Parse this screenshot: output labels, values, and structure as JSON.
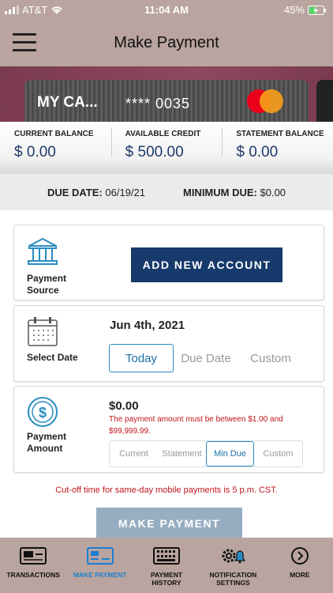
{
  "status_bar": {
    "carrier": "AT&T",
    "time": "11:04 AM",
    "battery": "45%"
  },
  "header": {
    "title": "Make Payment"
  },
  "card": {
    "name": "MY CA...",
    "masked_number": "**** 0035"
  },
  "balances": [
    {
      "label": "CURRENT BALANCE",
      "value": "$ 0.00"
    },
    {
      "label": "AVAILABLE CREDIT",
      "value": "$ 500.00"
    },
    {
      "label": "STATEMENT BALANCE",
      "value": "$ 0.00"
    }
  ],
  "due": {
    "date_label": "DUE DATE:",
    "date_value": "06/19/21",
    "min_label": "MINIMUM DUE:",
    "min_value": "$0.00"
  },
  "source": {
    "label_1": "Payment",
    "label_2": "Source",
    "button": "ADD NEW ACCOUNT"
  },
  "date": {
    "label": "Select Date",
    "value": "Jun 4th, 2021",
    "options": [
      "Today",
      "Due Date",
      "Custom"
    ]
  },
  "amount": {
    "label_1": "Payment",
    "label_2": "Amount",
    "value": "$0.00",
    "error": "The payment amount must be between $1.00 and $99,999.99.",
    "options": [
      "Current",
      "Statement",
      "Min Due",
      "Custom"
    ]
  },
  "cutoff": "Cut-off time for same-day mobile payments is 5 p.m. CST.",
  "pay_button": "MAKE PAYMENT",
  "tabs": [
    {
      "line1": "TRANSACTIONS",
      "line2": ""
    },
    {
      "line1": "MAKE PAYMENT",
      "line2": ""
    },
    {
      "line1": "PAYMENT",
      "line2": "HISTORY"
    },
    {
      "line1": "NOTIFICATION",
      "line2": "SETTINGS"
    },
    {
      "line1": "MORE",
      "line2": ""
    }
  ],
  "colors": {
    "accent": "#163a6b",
    "error": "#c0141c",
    "active_tab": "#1b7fd1",
    "chrome": "#b9a49f"
  }
}
